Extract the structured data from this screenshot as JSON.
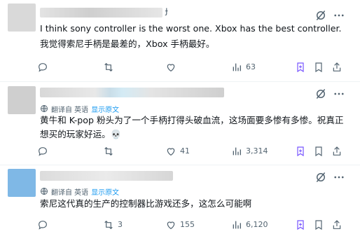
{
  "posts": [
    {
      "text": "I think sony controller is the worst one. Xbox has the best controller.",
      "translation": "我觉得索尼手柄是最差的，Xbox 手柄最好。",
      "metrics": {
        "replies": "",
        "reposts": "",
        "likes": "",
        "views": "63"
      }
    },
    {
      "translate_label": "翻译自 英语",
      "translate_link": "显示原文",
      "text": "黄牛和 K-pop 粉头为了一个手柄打得头破血流，这场面要多惨有多惨。祝真正想买的玩家好运。💀",
      "metrics": {
        "replies": "",
        "reposts": "",
        "likes": "41",
        "views": "3,314"
      }
    },
    {
      "translate_label": "翻译自 英语",
      "translate_link": "显示原文",
      "text": "索尼这代真的生产的控制器比游戏还多，这怎么可能啊",
      "metrics": {
        "replies": "",
        "reposts": "3",
        "likes": "155",
        "views": "6,120"
      }
    }
  ],
  "icons": {
    "grok": "grok-icon",
    "more": "more-icon",
    "reply": "reply-icon",
    "repost": "repost-icon",
    "like": "like-icon",
    "views": "views-icon",
    "bookmark": "bookmark-icon",
    "share": "share-icon",
    "translate": "translate-icon"
  },
  "colors": {
    "text": "#0f1419",
    "muted": "#536471",
    "link": "#1d9bf0",
    "bookmark_active": "#7856ff"
  }
}
